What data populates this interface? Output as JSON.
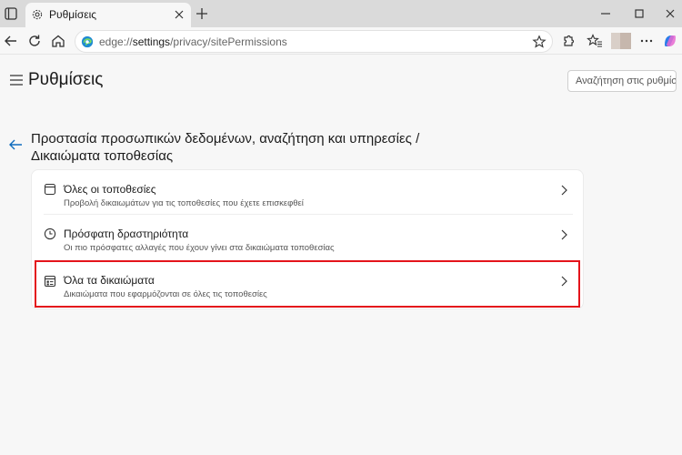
{
  "tab": {
    "title": "Ρυθμίσεις"
  },
  "address": {
    "scheme": "edge://",
    "host": "settings",
    "path": "/privacy/sitePermissions"
  },
  "settings": {
    "title": "Ρυθμίσεις",
    "search_placeholder": "Αναζήτηση στις ρυθμίσεις"
  },
  "page": {
    "heading_line1": "Προστασία προσωπικών δεδομένων, αναζήτηση και υπηρεσίες /",
    "heading_line2": "Δικαιώματα τοποθεσίας"
  },
  "rows": [
    {
      "title": "Όλες οι τοποθεσίες",
      "subtitle": "Προβολή δικαιωμάτων για τις τοποθεσίες που έχετε επισκεφθεί",
      "icon": "browser-window-icon"
    },
    {
      "title": "Πρόσφατη δραστηριότητα",
      "subtitle": "Οι πιο πρόσφατες αλλαγές που έχουν γίνει στα δικαιώματα τοποθεσίας",
      "icon": "clock-icon"
    },
    {
      "title": "Όλα τα δικαιώματα",
      "subtitle": "Δικαιώματα που εφαρμόζονται σε όλες τις τοποθεσίες",
      "icon": "permissions-list-icon"
    }
  ],
  "colors": {
    "highlight": "#e4141b",
    "accent": "#0f6cbd"
  }
}
